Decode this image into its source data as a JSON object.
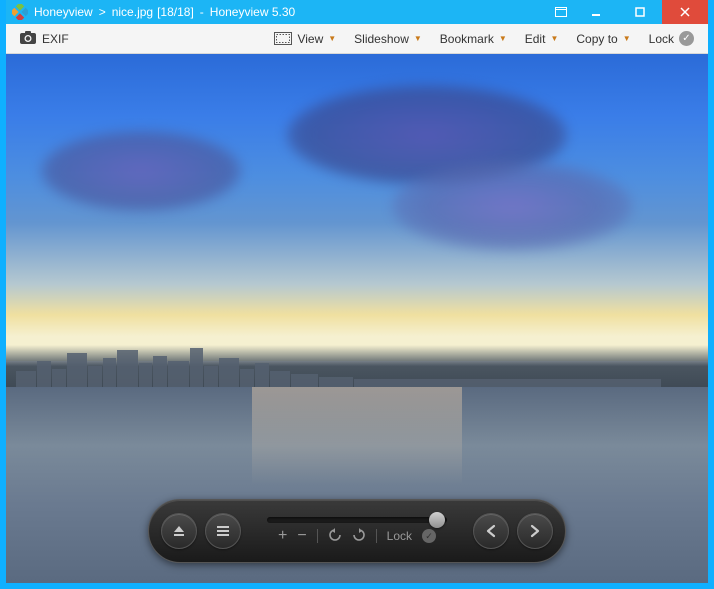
{
  "titlebar": {
    "app_name": "Honeyview",
    "sep": ">",
    "file_name": "nice.jpg",
    "counter": "[18/18]",
    "dash": "-",
    "app_version": "Honeyview 5.30"
  },
  "toolbar": {
    "exif": "EXIF",
    "view": "View",
    "slideshow": "Slideshow",
    "bookmark": "Bookmark",
    "edit": "Edit",
    "copy_to": "Copy to",
    "lock": "Lock"
  },
  "overlay": {
    "lock": "Lock"
  },
  "icons": {
    "plus": "+",
    "minus": "−",
    "check": "✓",
    "triangle_down": "▼"
  }
}
